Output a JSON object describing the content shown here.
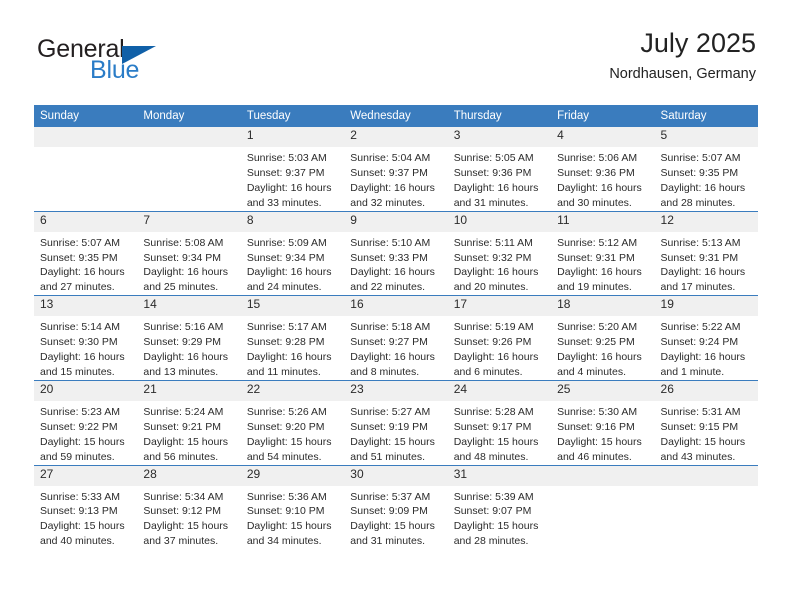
{
  "logo": {
    "word_top": "General",
    "word_bottom": "Blue",
    "triangle_icon": "triangle-icon",
    "brand_color": "#1060a8",
    "accent_color": "#2a7cc7"
  },
  "header": {
    "title": "July 2025",
    "subtitle": "Nordhausen, Germany"
  },
  "theme": {
    "header_blue": "#3a7cbe",
    "daynum_gray": "#f0f0f0",
    "text_color": "#2b2b2b"
  },
  "weekday_headers": [
    "Sunday",
    "Monday",
    "Tuesday",
    "Wednesday",
    "Thursday",
    "Friday",
    "Saturday"
  ],
  "weeks": [
    [
      {
        "day": "",
        "sunrise": "",
        "sunset": "",
        "daylight": ""
      },
      {
        "day": "",
        "sunrise": "",
        "sunset": "",
        "daylight": ""
      },
      {
        "day": "1",
        "sunrise": "Sunrise: 5:03 AM",
        "sunset": "Sunset: 9:37 PM",
        "daylight": "Daylight: 16 hours and 33 minutes."
      },
      {
        "day": "2",
        "sunrise": "Sunrise: 5:04 AM",
        "sunset": "Sunset: 9:37 PM",
        "daylight": "Daylight: 16 hours and 32 minutes."
      },
      {
        "day": "3",
        "sunrise": "Sunrise: 5:05 AM",
        "sunset": "Sunset: 9:36 PM",
        "daylight": "Daylight: 16 hours and 31 minutes."
      },
      {
        "day": "4",
        "sunrise": "Sunrise: 5:06 AM",
        "sunset": "Sunset: 9:36 PM",
        "daylight": "Daylight: 16 hours and 30 minutes."
      },
      {
        "day": "5",
        "sunrise": "Sunrise: 5:07 AM",
        "sunset": "Sunset: 9:35 PM",
        "daylight": "Daylight: 16 hours and 28 minutes."
      }
    ],
    [
      {
        "day": "6",
        "sunrise": "Sunrise: 5:07 AM",
        "sunset": "Sunset: 9:35 PM",
        "daylight": "Daylight: 16 hours and 27 minutes."
      },
      {
        "day": "7",
        "sunrise": "Sunrise: 5:08 AM",
        "sunset": "Sunset: 9:34 PM",
        "daylight": "Daylight: 16 hours and 25 minutes."
      },
      {
        "day": "8",
        "sunrise": "Sunrise: 5:09 AM",
        "sunset": "Sunset: 9:34 PM",
        "daylight": "Daylight: 16 hours and 24 minutes."
      },
      {
        "day": "9",
        "sunrise": "Sunrise: 5:10 AM",
        "sunset": "Sunset: 9:33 PM",
        "daylight": "Daylight: 16 hours and 22 minutes."
      },
      {
        "day": "10",
        "sunrise": "Sunrise: 5:11 AM",
        "sunset": "Sunset: 9:32 PM",
        "daylight": "Daylight: 16 hours and 20 minutes."
      },
      {
        "day": "11",
        "sunrise": "Sunrise: 5:12 AM",
        "sunset": "Sunset: 9:31 PM",
        "daylight": "Daylight: 16 hours and 19 minutes."
      },
      {
        "day": "12",
        "sunrise": "Sunrise: 5:13 AM",
        "sunset": "Sunset: 9:31 PM",
        "daylight": "Daylight: 16 hours and 17 minutes."
      }
    ],
    [
      {
        "day": "13",
        "sunrise": "Sunrise: 5:14 AM",
        "sunset": "Sunset: 9:30 PM",
        "daylight": "Daylight: 16 hours and 15 minutes."
      },
      {
        "day": "14",
        "sunrise": "Sunrise: 5:16 AM",
        "sunset": "Sunset: 9:29 PM",
        "daylight": "Daylight: 16 hours and 13 minutes."
      },
      {
        "day": "15",
        "sunrise": "Sunrise: 5:17 AM",
        "sunset": "Sunset: 9:28 PM",
        "daylight": "Daylight: 16 hours and 11 minutes."
      },
      {
        "day": "16",
        "sunrise": "Sunrise: 5:18 AM",
        "sunset": "Sunset: 9:27 PM",
        "daylight": "Daylight: 16 hours and 8 minutes."
      },
      {
        "day": "17",
        "sunrise": "Sunrise: 5:19 AM",
        "sunset": "Sunset: 9:26 PM",
        "daylight": "Daylight: 16 hours and 6 minutes."
      },
      {
        "day": "18",
        "sunrise": "Sunrise: 5:20 AM",
        "sunset": "Sunset: 9:25 PM",
        "daylight": "Daylight: 16 hours and 4 minutes."
      },
      {
        "day": "19",
        "sunrise": "Sunrise: 5:22 AM",
        "sunset": "Sunset: 9:24 PM",
        "daylight": "Daylight: 16 hours and 1 minute."
      }
    ],
    [
      {
        "day": "20",
        "sunrise": "Sunrise: 5:23 AM",
        "sunset": "Sunset: 9:22 PM",
        "daylight": "Daylight: 15 hours and 59 minutes."
      },
      {
        "day": "21",
        "sunrise": "Sunrise: 5:24 AM",
        "sunset": "Sunset: 9:21 PM",
        "daylight": "Daylight: 15 hours and 56 minutes."
      },
      {
        "day": "22",
        "sunrise": "Sunrise: 5:26 AM",
        "sunset": "Sunset: 9:20 PM",
        "daylight": "Daylight: 15 hours and 54 minutes."
      },
      {
        "day": "23",
        "sunrise": "Sunrise: 5:27 AM",
        "sunset": "Sunset: 9:19 PM",
        "daylight": "Daylight: 15 hours and 51 minutes."
      },
      {
        "day": "24",
        "sunrise": "Sunrise: 5:28 AM",
        "sunset": "Sunset: 9:17 PM",
        "daylight": "Daylight: 15 hours and 48 minutes."
      },
      {
        "day": "25",
        "sunrise": "Sunrise: 5:30 AM",
        "sunset": "Sunset: 9:16 PM",
        "daylight": "Daylight: 15 hours and 46 minutes."
      },
      {
        "day": "26",
        "sunrise": "Sunrise: 5:31 AM",
        "sunset": "Sunset: 9:15 PM",
        "daylight": "Daylight: 15 hours and 43 minutes."
      }
    ],
    [
      {
        "day": "27",
        "sunrise": "Sunrise: 5:33 AM",
        "sunset": "Sunset: 9:13 PM",
        "daylight": "Daylight: 15 hours and 40 minutes."
      },
      {
        "day": "28",
        "sunrise": "Sunrise: 5:34 AM",
        "sunset": "Sunset: 9:12 PM",
        "daylight": "Daylight: 15 hours and 37 minutes."
      },
      {
        "day": "29",
        "sunrise": "Sunrise: 5:36 AM",
        "sunset": "Sunset: 9:10 PM",
        "daylight": "Daylight: 15 hours and 34 minutes."
      },
      {
        "day": "30",
        "sunrise": "Sunrise: 5:37 AM",
        "sunset": "Sunset: 9:09 PM",
        "daylight": "Daylight: 15 hours and 31 minutes."
      },
      {
        "day": "31",
        "sunrise": "Sunrise: 5:39 AM",
        "sunset": "Sunset: 9:07 PM",
        "daylight": "Daylight: 15 hours and 28 minutes."
      },
      {
        "day": "",
        "sunrise": "",
        "sunset": "",
        "daylight": ""
      },
      {
        "day": "",
        "sunrise": "",
        "sunset": "",
        "daylight": ""
      }
    ]
  ]
}
